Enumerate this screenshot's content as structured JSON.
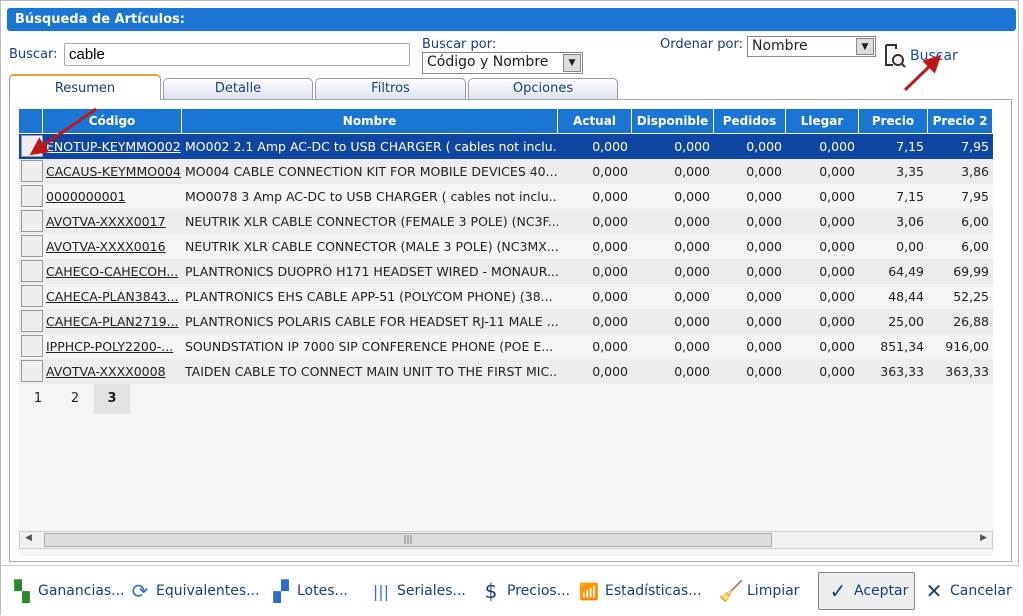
{
  "title": "Búsqueda de Artículos:",
  "search": {
    "label": "Buscar:",
    "value": "cable"
  },
  "search_by": {
    "label": "Buscar por:",
    "value": "Código y Nombre"
  },
  "order_by": {
    "label": "Ordenar por:",
    "value": "Nombre"
  },
  "search_button": "Buscar",
  "tabs": [
    {
      "label": "Resumen",
      "active": true
    },
    {
      "label": "Detalle"
    },
    {
      "label": "Filtros"
    },
    {
      "label": "Opciones"
    }
  ],
  "columns": [
    "Código",
    "Nombre",
    "Actual",
    "Disponible",
    "Pedidos",
    "Llegar",
    "Precio",
    "Precio 2"
  ],
  "rows": [
    [
      "ENOTUP-KEYMMO002",
      "MO002 2.1 Amp AC-DC to USB CHARGER ( cables not inclu...",
      "0,000",
      "0,000",
      "0,000",
      "0,000",
      "7,15",
      "7,95"
    ],
    [
      "CACAUS-KEYMMO004",
      "MO004 CABLE CONNECTION KIT FOR MOBILE DEVICES 40...",
      "0,000",
      "0,000",
      "0,000",
      "0,000",
      "3,35",
      "3,86"
    ],
    [
      "0000000001",
      "MO0078 3 Amp AC-DC to USB CHARGER ( cables not inclu...",
      "0,000",
      "0,000",
      "0,000",
      "0,000",
      "7,15",
      "7,95"
    ],
    [
      "AVOTVA-XXXX0017",
      "NEUTRIK XLR CABLE CONNECTOR (FEMALE 3 POLE) (NC3F...",
      "0,000",
      "0,000",
      "0,000",
      "0,000",
      "3,06",
      "6,00"
    ],
    [
      "AVOTVA-XXXX0016",
      "NEUTRIK XLR CABLE CONNECTOR (MALE 3 POLE) (NC3MX...",
      "0,000",
      "0,000",
      "0,000",
      "0,000",
      "0,00",
      "6,00"
    ],
    [
      "CAHECO-CAHECOH...",
      "PLANTRONICS DUOPRO H171 HEADSET WIRED - MONAUR...",
      "0,000",
      "0,000",
      "0,000",
      "0,000",
      "64,49",
      "69,99"
    ],
    [
      "CAHECA-PLAN3843...",
      "PLANTRONICS EHS CABLE APP-51 (POLYCOM PHONE) (38...",
      "0,000",
      "0,000",
      "0,000",
      "0,000",
      "48,44",
      "52,25"
    ],
    [
      "CAHECA-PLAN2719...",
      "PLANTRONICS POLARIS CABLE FOR HEADSET RJ-11 MALE ...",
      "0,000",
      "0,000",
      "0,000",
      "0,000",
      "25,00",
      "26,88"
    ],
    [
      "IPPHCP-POLY2200-...",
      "SOUNDSTATION IP 7000 SIP CONFERENCE PHONE (POE E...",
      "0,000",
      "0,000",
      "0,000",
      "0,000",
      "851,34",
      "916,00"
    ],
    [
      "AVOTVA-XXXX0008",
      "TAIDEN CABLE TO CONNECT MAIN UNIT TO THE FIRST MIC...",
      "0,000",
      "0,000",
      "0,000",
      "0,000",
      "363,33",
      "363,33"
    ]
  ],
  "selected_row": 0,
  "pages": [
    "1",
    "2",
    "3"
  ],
  "current_page": "3",
  "footer_buttons": [
    {
      "label": "Ganancias...",
      "icon": "profit-icon"
    },
    {
      "label": "Equivalentes...",
      "icon": "equivalents-icon"
    },
    {
      "label": "Lotes...",
      "icon": "lots-icon"
    },
    {
      "label": "Seriales...",
      "icon": "barcode-icon"
    },
    {
      "label": "Precios...",
      "icon": "dollar-icon"
    },
    {
      "label": "Estadísticas...",
      "icon": "chart-icon"
    },
    {
      "label": "Limpiar",
      "icon": "broom-icon"
    },
    {
      "label": "Aceptar",
      "icon": "check-icon"
    },
    {
      "label": "Cancelar",
      "icon": "close-icon"
    }
  ],
  "colors": {
    "header": "#1a76d2",
    "selected_row": "#0e47a1",
    "annotation_arrow": "#c0161b"
  }
}
